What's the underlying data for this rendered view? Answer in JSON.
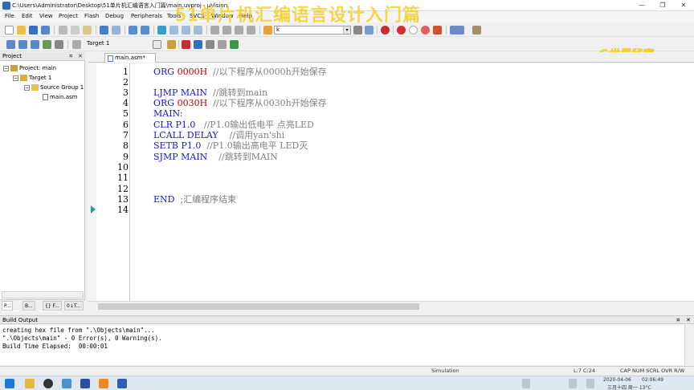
{
  "window": {
    "title": "C:\\Users\\Administrator\\Desktop\\51单片机汇编语言入门篇\\main.uvproj - µVision",
    "controls": [
      "—",
      "❐",
      "✕"
    ]
  },
  "overlay": {
    "title": "51单片机汇编语言设计入门篇",
    "brand": "C世界秘密"
  },
  "menu": [
    "File",
    "Edit",
    "View",
    "Project",
    "Flash",
    "Debug",
    "Peripherals",
    "Tools",
    "SVCS",
    "Window",
    "Help"
  ],
  "toolbar": {
    "find_text": "k",
    "target": "Target 1"
  },
  "project_panel": {
    "title": "Project",
    "tree": [
      {
        "label": "Project: main",
        "toggle": "−"
      },
      {
        "label": "Target 1",
        "toggle": "−"
      },
      {
        "label": "Source Group 1",
        "toggle": "−"
      },
      {
        "label": "main.asm",
        "toggle": ""
      }
    ],
    "tabs": [
      "P...",
      "B...",
      "{} F...",
      "0↓T..."
    ]
  },
  "editor": {
    "tab": "main.asm*",
    "line_numbers": [
      "1",
      "2",
      "3",
      "4",
      "5",
      "6",
      "7",
      "8",
      "9",
      "10",
      "11",
      "12",
      "13",
      "14"
    ],
    "lines": [
      {
        "a": "ORG ",
        "b": "0000H",
        "c": "  //以下程序从0000h开始保存"
      },
      {
        "a": "",
        "b": "",
        "c": ""
      },
      {
        "a": "LJMP MAIN",
        "b": "",
        "c": "  //跳转到main"
      },
      {
        "a": "ORG ",
        "b": "0030H",
        "c": "  //以下程序从0030h开始保存"
      },
      {
        "a": "MAIN:",
        "b": "",
        "c": ""
      },
      {
        "a": "CLR P1.0",
        "b": "",
        "c": "   //P1.0输出低电平 点亮LED"
      },
      {
        "a": "LCALL DELAY",
        "b": "",
        "c": "    //调用yan'shi"
      },
      {
        "a": "SETB P1.0",
        "b": "",
        "c": "  //P1.0输出高电平 LED灭"
      },
      {
        "a": "SJMP MAIN",
        "b": "",
        "c": "    //跳转到MAIN"
      },
      {
        "a": "",
        "b": "",
        "c": ""
      },
      {
        "a": "",
        "b": "",
        "c": ""
      },
      {
        "a": "",
        "b": "",
        "c": ""
      },
      {
        "a": "END",
        "b": "",
        "c": "  ;汇编程序结束"
      },
      {
        "a": "",
        "b": "",
        "c": ""
      }
    ]
  },
  "build_output": {
    "title": "Build Output",
    "lines": [
      "creating hex file from \".\\Objects\\main\"...",
      "\".\\Objects\\main\" - 0 Error(s), 0 Warning(s).",
      "Build Time Elapsed:  00:00:01"
    ]
  },
  "status": {
    "mode": "Simulation",
    "position": "L:7 C:24",
    "indicators": "CAP  NUM  SCRL  OVR  R/W"
  },
  "taskbar": {
    "time": "02:06:49",
    "date": "2020-04-06",
    "weather": "三月十四 周一 13°C"
  },
  "colors": {
    "keyword": "#1717c6",
    "number": "#c00000",
    "comment": "#808080",
    "overlay": "#ffd400"
  }
}
